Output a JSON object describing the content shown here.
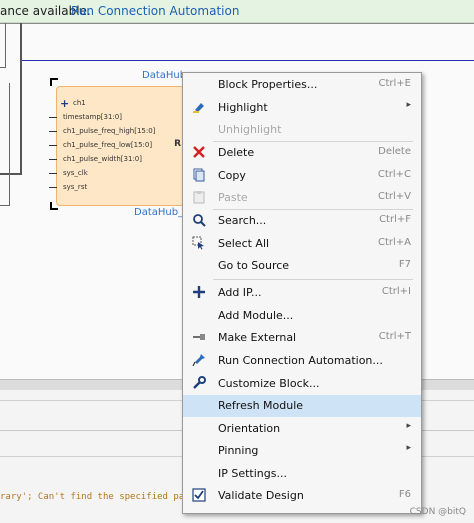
{
  "banner": {
    "message": "ance available.",
    "link": "Run Connection Automation"
  },
  "block": {
    "name_top": "DataHub_",
    "name_bottom": "DataHub_",
    "plus_symbol": "+",
    "ports": [
      "ch1",
      "timestamp[31:0]",
      "ch1_pulse_freq_high[15:0]",
      "ch1_pulse_freq_low[15:0]",
      "ch1_pulse_width[31:0]",
      "sys_clk",
      "sys_rst"
    ],
    "right_badge": "R"
  },
  "console": {
    "line1": "rary'; Can't find the specified path",
    "line2": ""
  },
  "menu": {
    "items": [
      {
        "label": "Block Properties...",
        "shortcut": "Ctrl+E",
        "icon": "none",
        "enabled": true
      },
      {
        "label": "Highlight",
        "shortcut": "",
        "icon": "highlight-icon",
        "submenu": true,
        "enabled": true
      },
      {
        "label": "Unhighlight",
        "shortcut": "",
        "icon": "none",
        "enabled": false
      },
      {
        "label": "Delete",
        "shortcut": "Delete",
        "icon": "delete-icon",
        "enabled": true
      },
      {
        "label": "Copy",
        "shortcut": "Ctrl+C",
        "icon": "copy-icon",
        "enabled": true
      },
      {
        "label": "Paste",
        "shortcut": "Ctrl+V",
        "icon": "paste-icon",
        "enabled": false
      },
      {
        "label": "Search...",
        "shortcut": "Ctrl+F",
        "icon": "search-icon",
        "enabled": true
      },
      {
        "label": "Select All",
        "shortcut": "Ctrl+A",
        "icon": "select-all-icon",
        "enabled": true
      },
      {
        "label": "Go to Source",
        "shortcut": "F7",
        "icon": "none",
        "enabled": true
      },
      {
        "label": "Add IP...",
        "shortcut": "Ctrl+I",
        "icon": "add-icon",
        "enabled": true
      },
      {
        "label": "Add Module...",
        "shortcut": "",
        "icon": "none",
        "enabled": true
      },
      {
        "label": "Make External",
        "shortcut": "Ctrl+T",
        "icon": "make-external-icon",
        "enabled": true
      },
      {
        "label": "Run Connection Automation...",
        "shortcut": "",
        "icon": "connection-automation-icon",
        "enabled": true
      },
      {
        "label": "Customize Block...",
        "shortcut": "",
        "icon": "wrench-icon",
        "enabled": true
      },
      {
        "label": "Refresh Module",
        "shortcut": "",
        "icon": "none",
        "enabled": true,
        "hovered": true
      },
      {
        "label": "Orientation",
        "shortcut": "",
        "icon": "none",
        "submenu": true,
        "enabled": true
      },
      {
        "label": "Pinning",
        "shortcut": "",
        "icon": "none",
        "submenu": true,
        "enabled": true
      },
      {
        "label": "IP Settings...",
        "shortcut": "",
        "icon": "none",
        "enabled": true
      },
      {
        "label": "Validate Design",
        "shortcut": "F6",
        "icon": "validate-icon",
        "enabled": true
      }
    ],
    "submenu_arrow": "▸"
  },
  "watermark": "CSDN @bitQ",
  "colors": {
    "banner_bg": "#e5f4e2",
    "link": "#1a5fb4",
    "block_fill": "#fde7c6",
    "block_border": "#f2b46a",
    "menu_hover": "#cfe3f7"
  }
}
